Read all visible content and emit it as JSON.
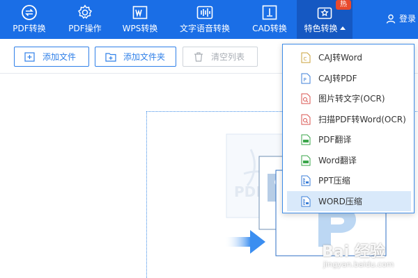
{
  "nav": {
    "items": [
      {
        "label": "PDF转换",
        "icon": "pdf-convert-icon"
      },
      {
        "label": "PDF操作",
        "icon": "pdf-operate-icon"
      },
      {
        "label": "WPS转换",
        "icon": "wps-convert-icon"
      },
      {
        "label": "文字语音转换",
        "icon": "voice-convert-icon"
      },
      {
        "label": "CAD转换",
        "icon": "cad-convert-icon"
      },
      {
        "label": "特色转换",
        "icon": "feature-convert-icon",
        "badge": "热",
        "active": true
      }
    ],
    "login_label": "登录",
    "colors": {
      "bar": "#1a6ee6",
      "active": "#1558c2",
      "badge": "#e8492c"
    }
  },
  "toolbar": {
    "add_file": "添加文件",
    "add_folder": "添加文件夹",
    "clear_list": "清空列表"
  },
  "dropdown": {
    "items": [
      {
        "label": "CAJ转Word",
        "icon": "caj-file-icon"
      },
      {
        "label": "CAJ转PDF",
        "icon": "pdf-file-icon"
      },
      {
        "label": "图片转文字(OCR)",
        "icon": "ocr-file-icon"
      },
      {
        "label": "扫描PDF转Word(OCR)",
        "icon": "ocr-file-icon"
      },
      {
        "label": "PDF翻译",
        "icon": "translate-file-icon"
      },
      {
        "label": "Word翻译",
        "icon": "translate-file-icon"
      },
      {
        "label": "PPT压缩",
        "icon": "compress-file-icon"
      },
      {
        "label": "WORD压缩",
        "icon": "compress-file-icon",
        "selected": true
      }
    ]
  },
  "watermark": {
    "line1": "Bai 经验",
    "line2": "jingyan.baidu.com"
  }
}
